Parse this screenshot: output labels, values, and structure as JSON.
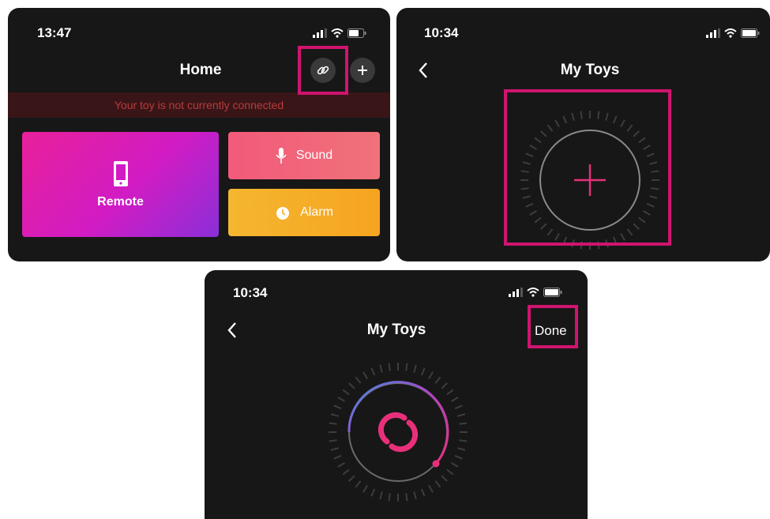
{
  "screen1": {
    "time": "13:47",
    "title": "Home",
    "banner": "Your toy is not currently connected",
    "tiles": {
      "remote": "Remote",
      "sound": "Sound",
      "alarm": "Alarm"
    },
    "icons": [
      "link-icon",
      "plus-icon",
      "phone-icon",
      "mic-icon",
      "alarm-clock-icon"
    ]
  },
  "screen2": {
    "time": "10:34",
    "title": "My Toys",
    "icons": [
      "back-chevron-icon",
      "add-toy-plus-icon"
    ]
  },
  "screen3": {
    "time": "10:34",
    "title": "My Toys",
    "done_label": "Done",
    "icons": [
      "back-chevron-icon",
      "scanning-spinner-icon"
    ]
  },
  "colors": {
    "highlight": "#d0146f",
    "accent_pink": "#e8307a",
    "accent_blue": "#3a8ee0",
    "panel_bg": "#171717"
  }
}
